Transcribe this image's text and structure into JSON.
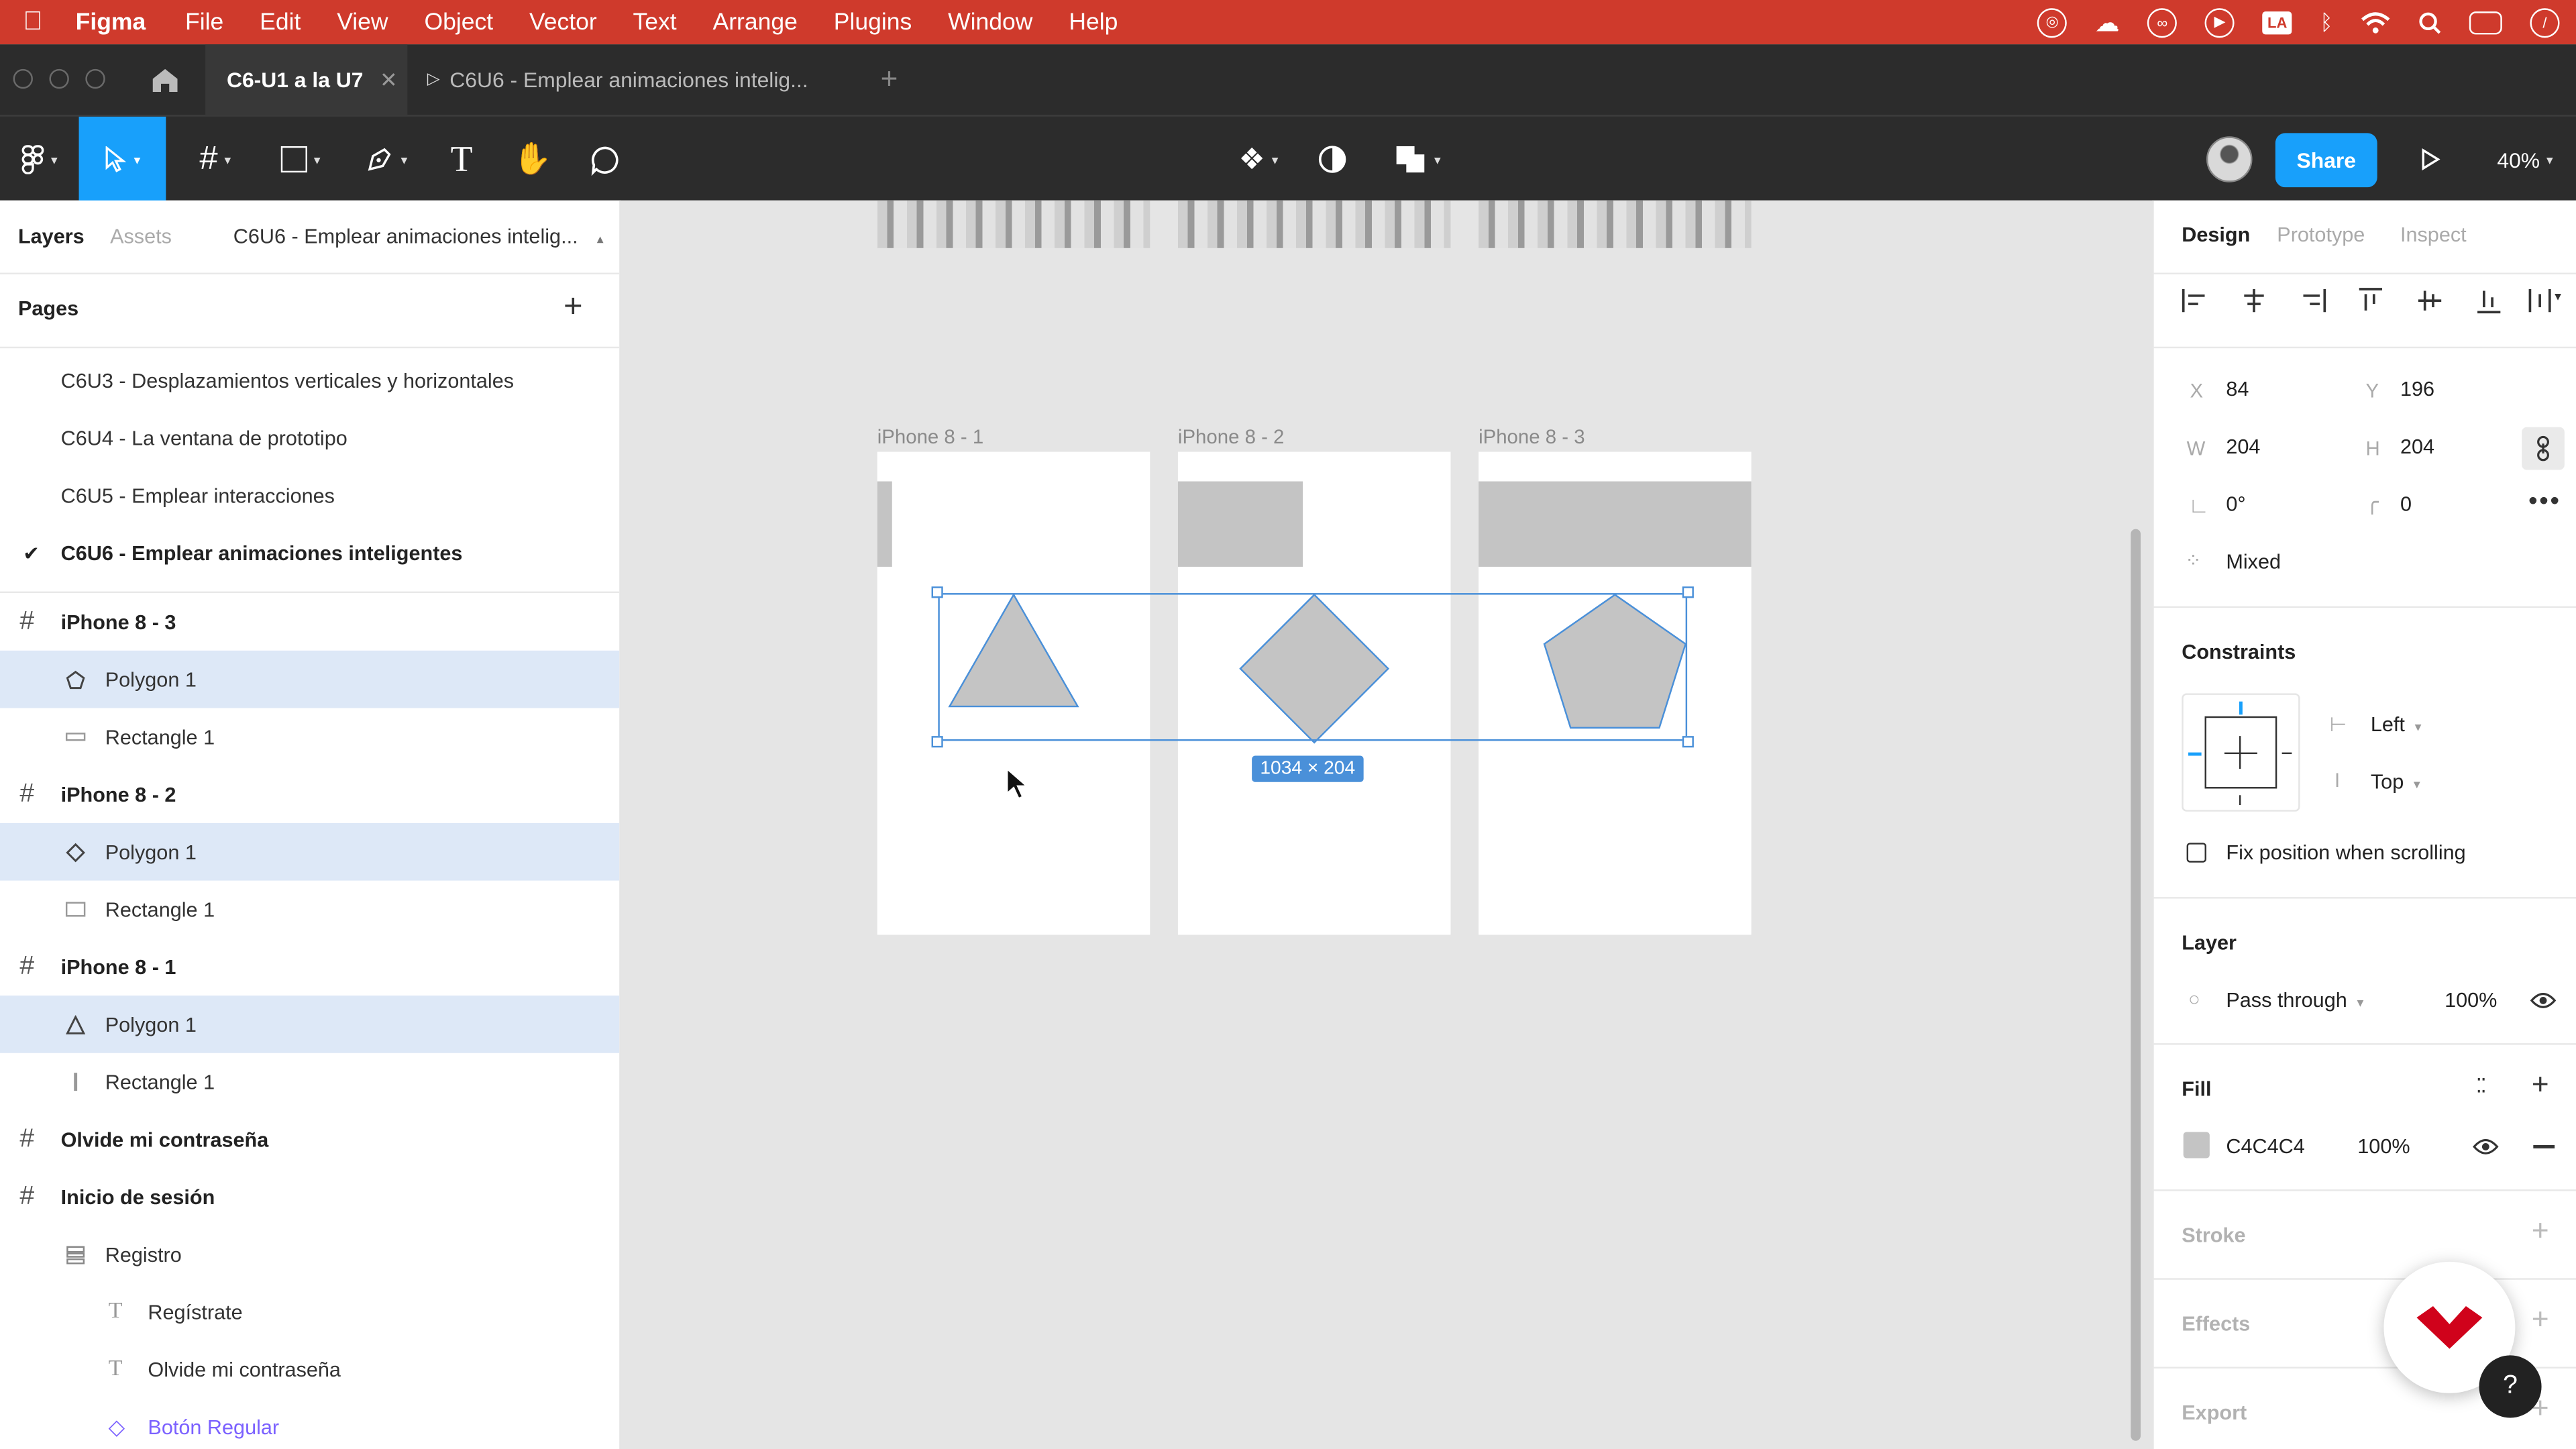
{
  "menubar": {
    "app": "Figma",
    "items": [
      "File",
      "Edit",
      "View",
      "Object",
      "Vector",
      "Text",
      "Arrange",
      "Plugins",
      "Window",
      "Help"
    ]
  },
  "tabs": {
    "active": "C6-U1 a la U7",
    "second": "C6U6 - Emplear animaciones intelig..."
  },
  "toolbar": {
    "share": "Share",
    "zoom": "40%"
  },
  "left": {
    "tab_layers": "Layers",
    "tab_assets": "Assets",
    "page_selector": "C6U6 - Emplear animaciones intelig...",
    "pages_title": "Pages",
    "pages": [
      "C6U3 - Desplazamientos verticales y horizontales",
      "C6U4 - La ventana de prototipo",
      "C6U5 - Emplear interacciones",
      "C6U6 - Emplear animaciones inteligentes"
    ],
    "layers": [
      "iPhone 8 - 3",
      "Polygon 1",
      "Rectangle 1",
      "iPhone 8 - 2",
      "Polygon 1",
      "Rectangle 1",
      "iPhone 8 - 1",
      "Polygon 1",
      "Rectangle 1",
      "Olvide mi contraseña",
      "Inicio de sesión",
      "Registro",
      "Regístrate",
      "Olvide mi contraseña",
      "Botón Regular"
    ]
  },
  "canvas": {
    "frames": [
      "iPhone 8 - 1",
      "iPhone 8 - 2",
      "iPhone 8 - 3"
    ],
    "selection_size": "1034 × 204"
  },
  "right": {
    "tab_design": "Design",
    "tab_prototype": "Prototype",
    "tab_inspect": "Inspect",
    "x_label": "X",
    "x": "84",
    "y_label": "Y",
    "y": "196",
    "w_label": "W",
    "w": "204",
    "h_label": "H",
    "h": "204",
    "rotation": "0°",
    "radius": "0",
    "mixed": "Mixed",
    "constraints_title": "Constraints",
    "constraint_h": "Left",
    "constraint_v": "Top",
    "fix_position": "Fix position when scrolling",
    "layer_title": "Layer",
    "blend": "Pass through",
    "layer_opacity": "100%",
    "fill_title": "Fill",
    "fill_hex": "C4C4C4",
    "fill_opacity": "100%",
    "stroke_title": "Stroke",
    "effects_title": "Effects",
    "export_title": "Export",
    "help": "?"
  },
  "colors": {
    "menubar": "#cf3a2c",
    "dark": "#2c2c2c",
    "accent": "#18a0fb",
    "fill": "#c4c4c4",
    "selection": "#4a90d9"
  }
}
